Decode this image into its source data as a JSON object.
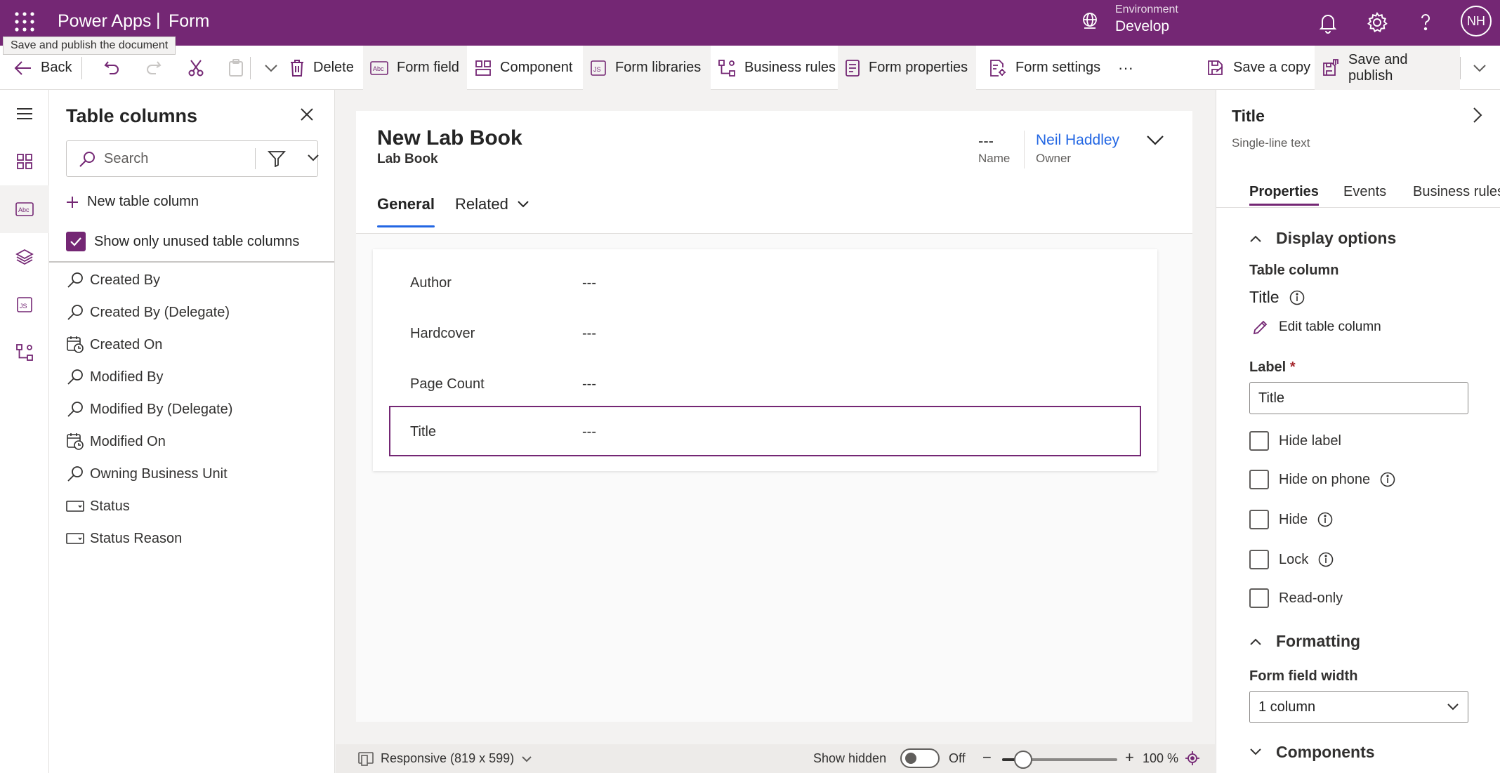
{
  "header": {
    "brand": "Power Apps",
    "separator": "|",
    "app_name": "Form",
    "environment_label": "Environment",
    "environment_value": "Develop",
    "avatar_initials": "NH",
    "accent_color": "#742774"
  },
  "tooltip": "Save and publish the document",
  "toolbar": {
    "back": "Back",
    "delete": "Delete",
    "form_field": "Form field",
    "component": "Component",
    "form_libraries": "Form libraries",
    "business_rules": "Business rules",
    "form_properties": "Form properties",
    "form_settings": "Form settings",
    "more": "···",
    "save_copy": "Save a copy",
    "save_publish": "Save and publish"
  },
  "left_rail": {
    "items": [
      "hamburger-icon",
      "components-icon",
      "table-columns-icon",
      "layers-icon",
      "form-libraries-icon",
      "business-rules-icon"
    ],
    "selected": "table-columns-icon"
  },
  "columns_panel": {
    "title": "Table columns",
    "search_placeholder": "Search",
    "new_column": "New table column",
    "show_unused": "Show only unused table columns",
    "show_unused_checked": true,
    "columns": [
      {
        "label": "Created By",
        "icon": "lookup-icon"
      },
      {
        "label": "Created By (Delegate)",
        "icon": "lookup-icon"
      },
      {
        "label": "Created On",
        "icon": "calendar-clock-icon"
      },
      {
        "label": "Modified By",
        "icon": "lookup-icon"
      },
      {
        "label": "Modified By (Delegate)",
        "icon": "lookup-icon"
      },
      {
        "label": "Modified On",
        "icon": "calendar-clock-icon"
      },
      {
        "label": "Owning Business Unit",
        "icon": "lookup-icon"
      },
      {
        "label": "Status",
        "icon": "option-set-icon"
      },
      {
        "label": "Status Reason",
        "icon": "option-set-icon"
      }
    ]
  },
  "form": {
    "title": "New Lab Book",
    "entity": "Lab Book",
    "name_value": "---",
    "name_label": "Name",
    "owner_value": "Neil Haddley",
    "owner_label": "Owner",
    "tabs": [
      "General",
      "Related"
    ],
    "active_tab": "General",
    "fields": [
      {
        "label": "Author",
        "value": "---"
      },
      {
        "label": "Hardcover",
        "value": "---"
      },
      {
        "label": "Page Count",
        "value": "---"
      },
      {
        "label": "Title",
        "value": "---",
        "selected": true
      }
    ]
  },
  "bottom_bar": {
    "responsive": "Responsive (819 x 599)",
    "show_hidden": "Show hidden",
    "toggle_state": "Off",
    "zoom_minus": "−",
    "zoom_plus": "+",
    "zoom": "100 %",
    "zoom_slider_fraction": 0.18
  },
  "properties": {
    "title": "Title",
    "subtitle": "Single-line text",
    "tabs": [
      "Properties",
      "Events",
      "Business rules"
    ],
    "active_tab": "Properties",
    "display_options": "Display options",
    "table_column_label": "Table column",
    "table_column_value": "Title",
    "edit_table_column": "Edit table column",
    "label_label": "Label",
    "required_mark": "*",
    "label_value": "Title",
    "checkboxes": [
      {
        "label": "Hide label",
        "info": false,
        "checked": false
      },
      {
        "label": "Hide on phone",
        "info": true,
        "checked": false
      },
      {
        "label": "Hide",
        "info": true,
        "checked": false
      },
      {
        "label": "Lock",
        "info": true,
        "checked": false
      },
      {
        "label": "Read-only",
        "info": false,
        "checked": false
      }
    ],
    "formatting": "Formatting",
    "form_field_width_label": "Form field width",
    "form_field_width_value": "1 column",
    "components": "Components"
  }
}
